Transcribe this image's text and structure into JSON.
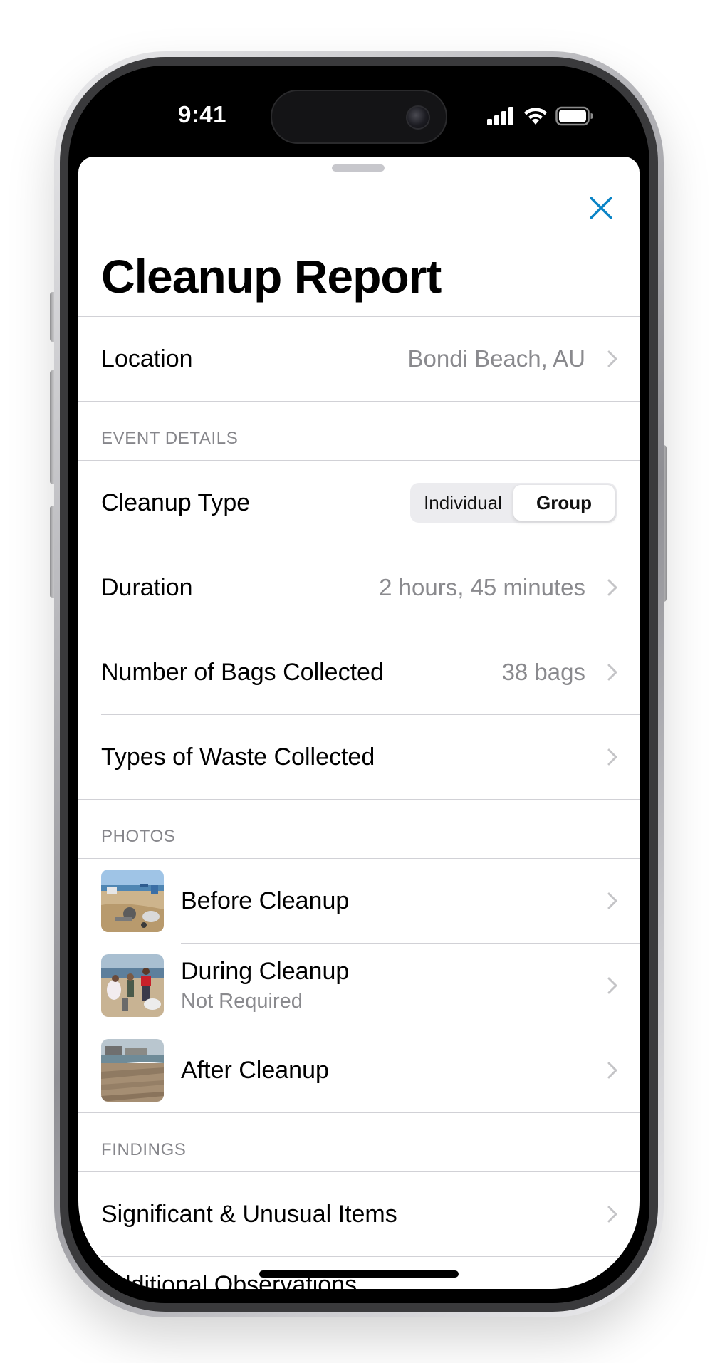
{
  "status_bar": {
    "time": "9:41"
  },
  "sheet": {
    "title": "Cleanup Report",
    "location": {
      "label": "Location",
      "value": "Bondi Beach, AU"
    },
    "event_details": {
      "header": "EVENT DETAILS",
      "cleanup_type": {
        "label": "Cleanup Type",
        "options": [
          "Individual",
          "Group"
        ],
        "selected": "Group"
      },
      "duration": {
        "label": "Duration",
        "value": "2 hours, 45 minutes"
      },
      "bags": {
        "label": "Number of Bags Collected",
        "value": "38 bags"
      },
      "waste_types": {
        "label": "Types of Waste Collected"
      }
    },
    "photos": {
      "header": "PHOTOS",
      "items": [
        {
          "title": "Before Cleanup",
          "subtitle": ""
        },
        {
          "title": "During Cleanup",
          "subtitle": "Not Required"
        },
        {
          "title": "After Cleanup",
          "subtitle": ""
        }
      ]
    },
    "findings": {
      "header": "FINDINGS",
      "items": [
        "Significant & Unusual Items",
        "Additional Observations"
      ]
    }
  },
  "colors": {
    "accent": "#0a84c6",
    "secondary_text": "#8a8a8e",
    "separator": "#d1d1d6"
  }
}
